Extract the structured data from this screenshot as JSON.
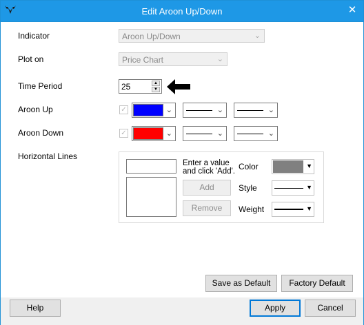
{
  "window": {
    "title": "Edit Aroon Up/Down",
    "close_glyph": "✕",
    "app_icon": "bull-logo-icon"
  },
  "fields": {
    "indicator": {
      "label": "Indicator",
      "value": "Aroon Up/Down"
    },
    "plot_on": {
      "label": "Plot on",
      "value": "Price Chart"
    },
    "time_period": {
      "label": "Time Period",
      "value": "25"
    },
    "aroon_up": {
      "label": "Aroon Up",
      "color": "#0000ff"
    },
    "aroon_down": {
      "label": "Aroon Down",
      "color": "#ff0000"
    },
    "horizontal_lines": {
      "label": "Horizontal Lines"
    }
  },
  "hlines": {
    "hint_line1": "Enter a value",
    "hint_line2": "and click 'Add'.",
    "add_label": "Add",
    "remove_label": "Remove",
    "color_label": "Color",
    "style_label": "Style",
    "weight_label": "Weight",
    "color": "#808080"
  },
  "buttons": {
    "save_default": "Save as Default",
    "factory_default": "Factory Default",
    "help": "Help",
    "apply": "Apply",
    "cancel": "Cancel"
  },
  "icons": {
    "chevron": "⌄"
  }
}
